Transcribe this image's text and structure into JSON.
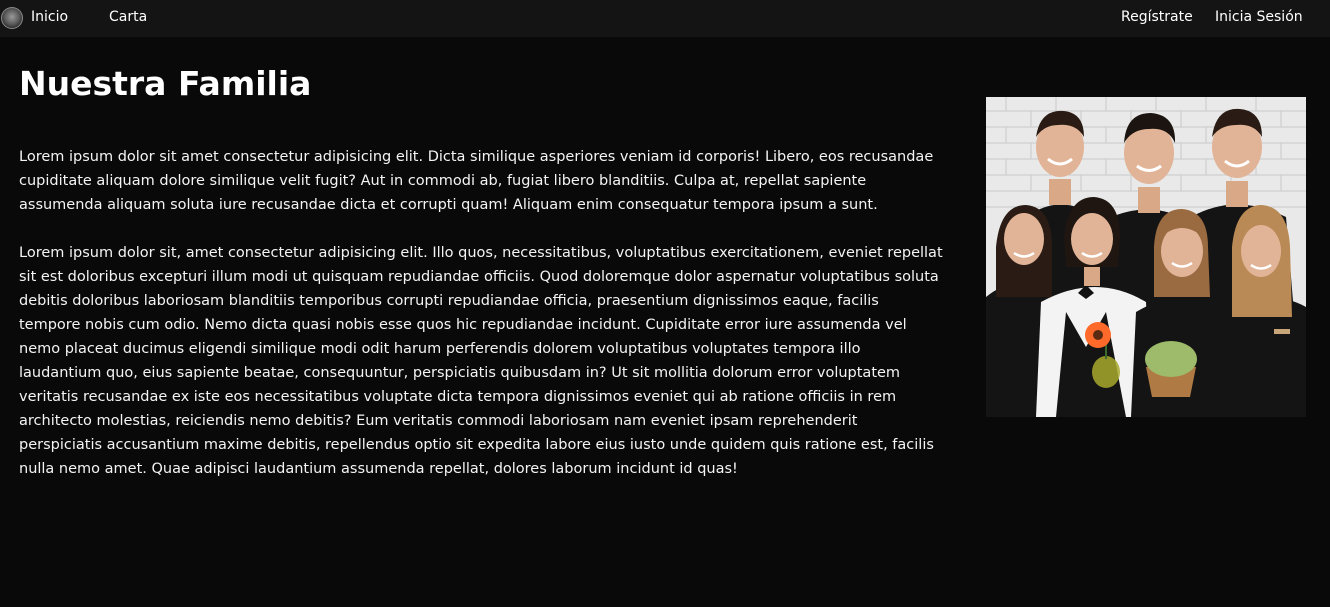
{
  "nav": {
    "logo_icon": "restaurant-logo-icon",
    "home_label": "Inicio",
    "menu_label": "Carta",
    "register_label": "Regístrate",
    "login_label": "Inicia Sesión"
  },
  "main": {
    "title": "Nuestra Familia",
    "paragraphs": [
      "Lorem ipsum dolor sit amet consectetur adipisicing elit. Dicta similique asperiores veniam id corporis! Libero, eos recusandae cupiditate aliquam dolore similique velit fugit? Aut in commodi ab, fugiat libero blanditiis. Culpa at, repellat sapiente assumenda aliquam soluta iure recusandae dicta et corrupti quam! Aliquam enim consequatur tempora ipsum a sunt.",
      "Lorem ipsum dolor sit, amet consectetur adipisicing elit. Illo quos, necessitatibus, voluptatibus exercitationem, eveniet repellat sit est doloribus excepturi illum modi ut quisquam repudiandae officiis. Quod doloremque dolor aspernatur voluptatibus soluta debitis doloribus laboriosam blanditiis temporibus corrupti repudiandae officia, praesentium dignissimos eaque, facilis tempore nobis cum odio. Nemo dicta quasi nobis esse quos hic repudiandae incidunt. Cupiditate error iure assumenda vel nemo placeat ducimus eligendi similique modi odit harum perferendis dolorem voluptatibus voluptates tempora illo laudantium quo, eius sapiente beatae, consequuntur, perspiciatis quibusdam in? Ut sit mollitia dolorum error voluptatem veritatis recusandae ex iste eos necessitatibus voluptate dicta tempora dignissimos eveniet qui ab ratione officiis in rem architecto molestias, reiciendis nemo debitis? Eum veritatis commodi laboriosam nam eveniet ipsam reprehenderit perspiciatis accusantium maxime debitis, repellendus optio sit expedita labore eius iusto unde quidem quis ratione est, facilis nulla nemo amet. Quae adipisci laudantium assumenda repellat, dolores laborum incidunt id quas!"
    ]
  },
  "photo": {
    "subject": "team-photo",
    "colors": {
      "wall": "#e9e9e9",
      "uniform": "#141414",
      "skin": "#e2b497",
      "hair_dark": "#2a1c14",
      "hair_light": "#b98a55",
      "flower": "#ff6a2a",
      "plant": "#9dbb6a"
    }
  }
}
